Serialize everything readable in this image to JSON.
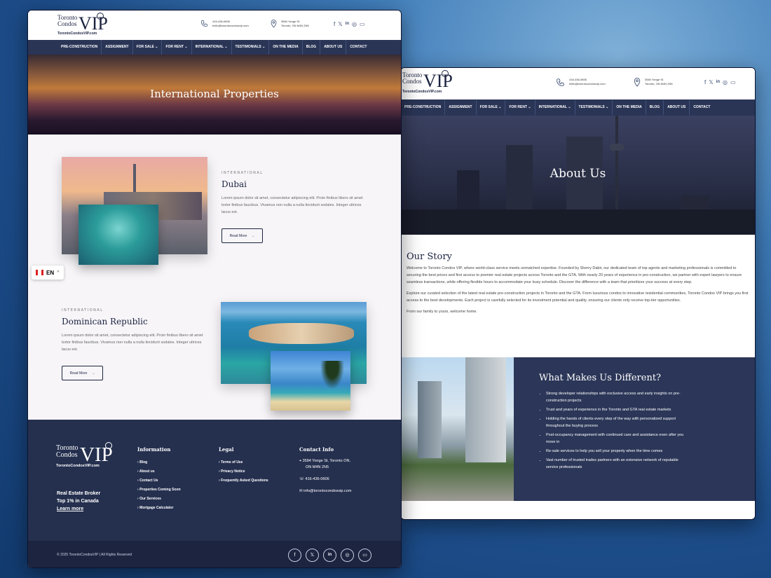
{
  "brand": {
    "logo_line1": "Toronto",
    "logo_line2": "Condos",
    "logo_vip": "VIP",
    "logo_url": "TorontoCondosVIP.com"
  },
  "header": {
    "phone_lines": [
      "416-436-0606",
      "hello@torontocondosvip.com"
    ],
    "address_lines": [
      "3584 Yonge St.",
      "Toronto, ON M4N 2N5"
    ],
    "social_icons": [
      "facebook-icon",
      "x-icon",
      "linkedin-icon",
      "instagram-icon",
      "youtube-icon"
    ]
  },
  "nav": {
    "items": [
      "PRE-CONSTRUCTION",
      "ASSIGNMENT",
      "FOR SALE ⌄",
      "FOR RENT ⌄",
      "INTERNATIONAL ⌄",
      "TESTIMONIALS ⌄",
      "ON THE MEDIA",
      "BLOG",
      "ABOUT US",
      "CONTACT"
    ]
  },
  "page1": {
    "hero_title": "International Properties",
    "properties": [
      {
        "kicker": "INTERNATIONAL",
        "title": "Dubai",
        "desc": "Lorem ipsum dolor sit amet, consectetur adipiscing elit. Proin finibus libero sit amet tortor finibus faucibus. Vivamus non nulla a nulla tincidunt sodales. Integer ultrices lacus est.",
        "button": "Read More"
      },
      {
        "kicker": "INTERNATIONAL",
        "title": "Dominican Republic",
        "desc": "Lorem ipsum dolor sit amet, consectetur adipiscing elit. Proin finibus libero sit amet tortor finibus faucibus. Vivamus non nulla a nulla tincidunt sodales. Integer ultrices lacus est.",
        "button": "Read More"
      }
    ],
    "lang": "EN"
  },
  "footer": {
    "tagline1": "Real Estate Broker",
    "tagline2": "Top 1% in Canada",
    "learn_more": "Learn more",
    "info_title": "Information",
    "info_items": [
      "Blog",
      "About us",
      "Contact Us",
      "Properties Coming Soon",
      "Our Services",
      "Mortgage Calculator"
    ],
    "legal_title": "Legal",
    "legal_items": [
      "Terms of Use",
      "Privacy Notice",
      "Frequently Asked Questions"
    ],
    "contact_title": "Contact Info",
    "contact_lines": [
      "3584 Yonge St, Toronto ON,",
      "ON M4N 2N5",
      "416-436-0606",
      "info@torontocondosvip.com"
    ],
    "copyright": "© 2025 TorontoCondosVIP | All Rights Reserved"
  },
  "page2": {
    "hero_title": "About Us",
    "story_title": "Our Story",
    "story_p1": "Welcome to Toronto Condos VIP, where world-class service meets unmatched expertise. Founded by Sherry Dabir, our dedicated team of top agents and marketing professionals is committed to securing the best prices and first access to premier real estate projects across Toronto and the GTA. With nearly 20 years of experience in pre-construction, we partner with expert lawyers to ensure seamless transactions, while offering flexible hours to accommodate your busy schedule. Discover the difference with a team that prioritizes your success at every step.",
    "story_p2": "Explore our curated selection of the latest real estate pre-construction projects in Toronto and the GTA. From luxurious condos to innovative residential communities, Toronto Condos VIP brings you first access to the best developments. Each project is carefully selected for its investment potential and quality, ensuring our clients only receive top-tier opportunities.",
    "story_p3": "From our family to yours, welcome home.",
    "diff_title": "What Makes Us Different?",
    "diff_items": [
      "Strong developer relationships with exclusive access and early insights on pre-construction projects",
      "Trust and years of experience in the Toronto and GTA real estate markets",
      "Holding the hands of clients every step of the way with personalized support throughout the buying process",
      "Post-occupancy management with continued care and assistance even after you move in",
      "Re-sale services to help you sell your property when the time comes",
      "Vast number of trusted trades partners with an extensive network of reputable service professionals"
    ]
  }
}
